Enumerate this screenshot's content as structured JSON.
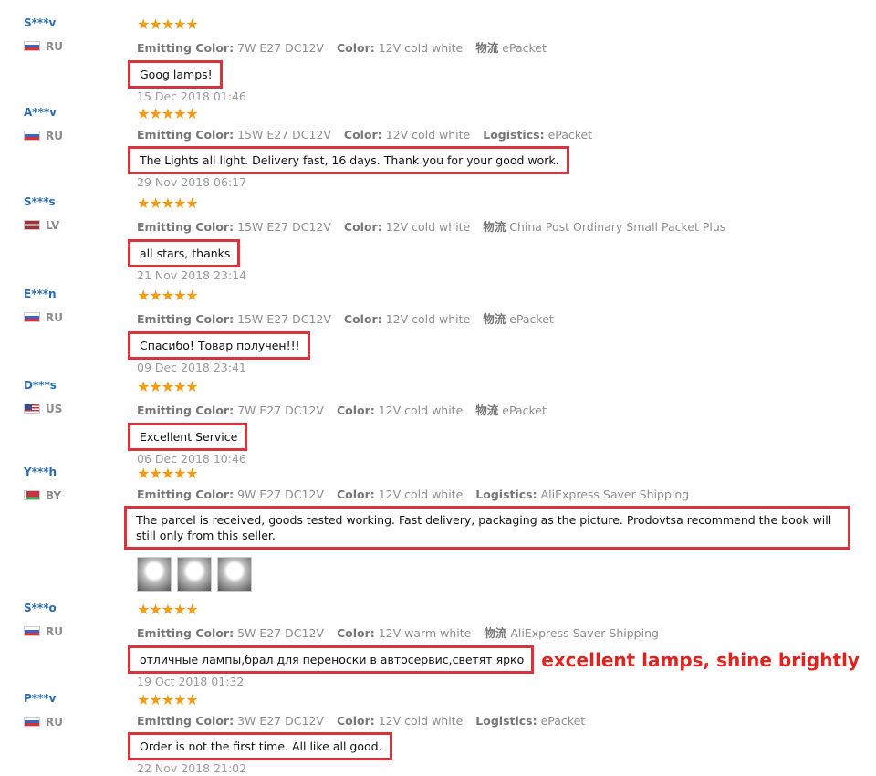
{
  "reviews": [
    {
      "name": "S***v",
      "country": "RU",
      "flag": "ru",
      "stars": "★★★★★",
      "attr1_label": "Emitting Color:",
      "attr1_value": "7W E27 DC12V",
      "attr2_label": "Color:",
      "attr2_value": "12V cold white",
      "attr3_label": "物流",
      "attr3_value": "ePacket",
      "text": "Goog lamps!",
      "date": "15 Dec 2018 01:46"
    },
    {
      "name": "A***v",
      "country": "RU",
      "flag": "ru",
      "stars": "★★★★★",
      "attr1_label": "Emitting Color:",
      "attr1_value": "15W E27 DC12V",
      "attr2_label": "Color:",
      "attr2_value": "12V cold white",
      "attr3_label": "Logistics:",
      "attr3_value": "ePacket",
      "text": "The Lights all light. Delivery fast, 16 days. Thank you for your good work.",
      "date": "29 Nov 2018 06:17"
    },
    {
      "name": "S***s",
      "country": "LV",
      "flag": "lv",
      "stars": "★★★★★",
      "attr1_label": "Emitting Color:",
      "attr1_value": "15W E27 DC12V",
      "attr2_label": "Color:",
      "attr2_value": "12V cold white",
      "attr3_label": "物流",
      "attr3_value": "China Post Ordinary Small Packet Plus",
      "text": "all stars, thanks",
      "date": "21 Nov 2018 23:14"
    },
    {
      "name": "E***n",
      "country": "RU",
      "flag": "ru",
      "stars": "★★★★★",
      "attr1_label": "Emitting Color:",
      "attr1_value": "15W E27 DC12V",
      "attr2_label": "Color:",
      "attr2_value": "12V cold white",
      "attr3_label": "物流",
      "attr3_value": "ePacket",
      "text": "Спасибо! Товар получен!!!",
      "date": "09 Dec 2018 23:41"
    },
    {
      "name": "D***s",
      "country": "US",
      "flag": "us",
      "stars": "★★★★★",
      "attr1_label": "Emitting Color:",
      "attr1_value": "7W E27 DC12V",
      "attr2_label": "Color:",
      "attr2_value": "12V cold white",
      "attr3_label": "物流",
      "attr3_value": "ePacket",
      "text": "Excellent Service",
      "date": "06 Dec 2018 10:46"
    },
    {
      "name": "Y***h",
      "country": "BY",
      "flag": "by",
      "stars": "★★★★★",
      "attr1_label": "Emitting Color:",
      "attr1_value": "9W E27 DC12V",
      "attr2_label": "Color:",
      "attr2_value": "12V cold white",
      "attr3_label": "Logistics:",
      "attr3_value": "AliExpress Saver Shipping",
      "text": "The parcel is received, goods tested working. Fast delivery, packaging as the picture. Prodovtsa recommend the book will still only from this seller.",
      "date": ""
    },
    {
      "name": "S***o",
      "country": "RU",
      "flag": "ru",
      "stars": "★★★★★",
      "attr1_label": "Emitting Color:",
      "attr1_value": "5W E27 DC12V",
      "attr2_label": "Color:",
      "attr2_value": "12V warm white",
      "attr3_label": "物流",
      "attr3_value": "AliExpress Saver Shipping",
      "text": "отличные лампы,брал для переноски в автосервис,светят ярко",
      "date": "19 Oct 2018 01:32",
      "translation": "excellent lamps, shine brightly"
    },
    {
      "name": "P***v",
      "country": "RU",
      "flag": "ru",
      "stars": "★★★★★",
      "attr1_label": "Emitting Color:",
      "attr1_value": "3W E27 DC12V",
      "attr2_label": "Color:",
      "attr2_value": "12V cold white",
      "attr3_label": "Logistics:",
      "attr3_value": "ePacket",
      "text": "Order is not the first time. All like all good.",
      "date": "22 Nov 2018 21:02"
    }
  ]
}
